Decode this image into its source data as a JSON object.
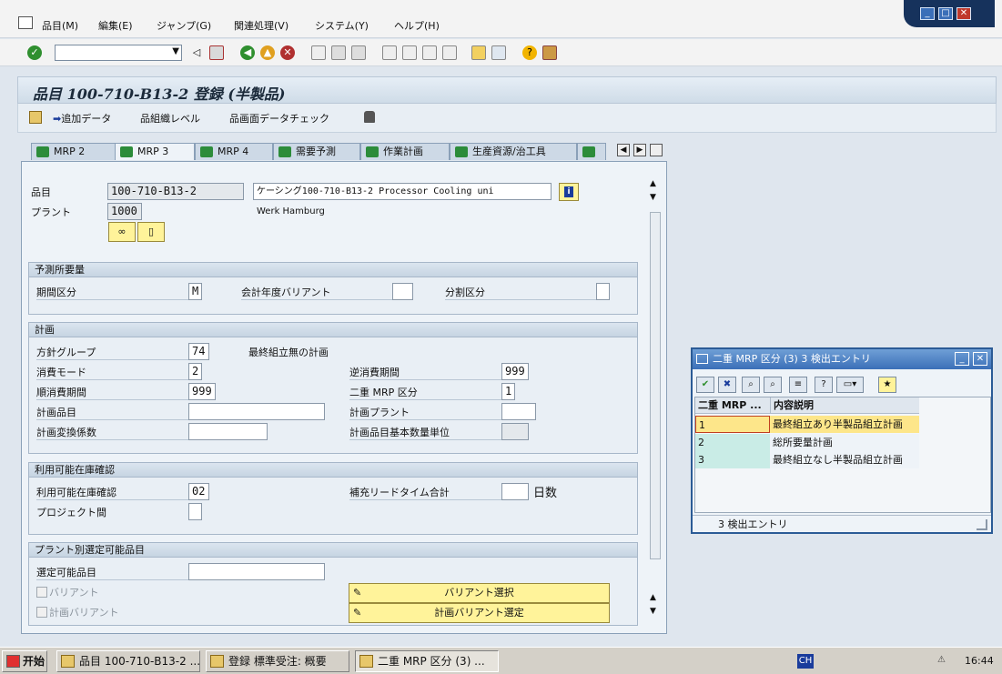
{
  "menu": {
    "items": [
      "品目(M)",
      "編集(E)",
      "ジャンプ(G)",
      "関連処理(V)",
      "システム(Y)",
      "ヘルプ(H)"
    ]
  },
  "toolbar": {
    "command_field": ""
  },
  "title": "品目 100-710-B13-2 登録 (半製品)",
  "app_toolbar": {
    "add_data": "追加データ",
    "org_level": "組織レベル",
    "screen_check": "画面データチェック"
  },
  "tabs": [
    "MRP 2",
    "MRP 3",
    "MRP 4",
    "需要予測",
    "作業計画",
    "生産資源/治工具"
  ],
  "header": {
    "material_label": "品目",
    "material_value": "100-710-B13-2",
    "material_desc": "ケーシング100-710-B13-2 Processor Cooling uni",
    "plant_label": "プラント",
    "plant_value": "1000",
    "plant_name": "Werk Hamburg"
  },
  "forecast": {
    "title": "予測所要量",
    "period_label": "期間区分",
    "period_value": "M",
    "fy_variant_label": "会計年度バリアント",
    "fy_variant_value": "",
    "split_label": "分割区分",
    "split_value": ""
  },
  "planning": {
    "title": "計画",
    "strategy_group_label": "方針グループ",
    "strategy_group_value": "74",
    "strategy_group_desc": "最終組立無の計画",
    "consumption_mode_label": "消費モード",
    "consumption_mode_value": "2",
    "bwd_period_label": "逆消費期間",
    "bwd_period_value": "999",
    "fwd_period_label": "順消費期間",
    "fwd_period_value": "999",
    "mixed_mrp_label": "二重 MRP 区分",
    "mixed_mrp_value": "1",
    "planning_material_label": "計画品目",
    "planning_material_value": "",
    "planning_plant_label": "計画プラント",
    "planning_plant_value": "",
    "conv_factor_label": "計画変換係数",
    "conv_factor_value": "",
    "base_unit_label": "計画品目基本数量単位",
    "base_unit_value": ""
  },
  "availability": {
    "title": "利用可能在庫確認",
    "check_label": "利用可能在庫確認",
    "check_value": "02",
    "tot_lead_label": "補充リードタイム合計",
    "tot_lead_value": "",
    "days_label": "日数",
    "cross_project_label": "プロジェクト間",
    "cross_project_value": ""
  },
  "plant_specific": {
    "title": "プラント別選定可能品目",
    "selectable_label": "選定可能品目",
    "selectable_value": "",
    "variant_label": "バリアント",
    "plan_variant_label": "計画バリアント",
    "variant_button": "バリアント選択",
    "plan_variant_button": "計画バリアント選定"
  },
  "popup": {
    "title": "二重 MRP 区分 (3)   3 検出エントリ",
    "col1": "二重 MRP ...",
    "col2": "内容説明",
    "rows": [
      {
        "code": "1",
        "desc": "最終組立あり半製品組立計画"
      },
      {
        "code": "2",
        "desc": "総所要量計画"
      },
      {
        "code": "3",
        "desc": "最終組立なし半製品組立計画"
      }
    ],
    "status": "3 検出エントリ"
  },
  "taskbar": {
    "start": "开始",
    "tasks": [
      "品目 100-710-B13-2 ...",
      "登録 標準受注: 概要",
      "二重 MRP 区分 (3) ..."
    ],
    "lang": "CH",
    "clock": "16:44"
  }
}
